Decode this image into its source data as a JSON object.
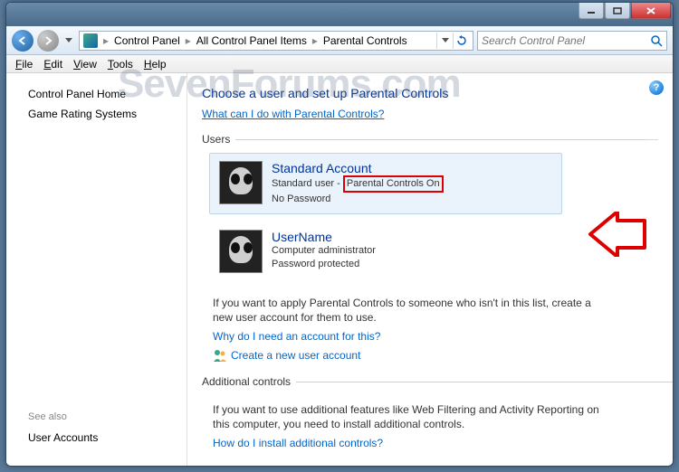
{
  "titlebar": {
    "min": "min",
    "max": "max",
    "close": "close"
  },
  "nav": {
    "breadcrumbs": [
      "Control Panel",
      "All Control Panel Items",
      "Parental Controls"
    ],
    "search_placeholder": "Search Control Panel"
  },
  "menu": {
    "file": "File",
    "edit": "Edit",
    "view": "View",
    "tools": "Tools",
    "help": "Help"
  },
  "sidebar": {
    "items": [
      "Control Panel Home",
      "Game Rating Systems"
    ],
    "seealso_label": "See also",
    "seealso_items": [
      "User Accounts"
    ]
  },
  "main": {
    "heading": "Choose a user and set up Parental Controls",
    "intro_link": "What can I do with Parental Controls?",
    "users_legend": "Users",
    "users": [
      {
        "name": "Standard Account",
        "type": "Standard user",
        "status": "Parental Controls On",
        "pw": "No Password",
        "selected": true,
        "highlighted": true
      },
      {
        "name": "UserName",
        "type": "Computer administrator",
        "status": "",
        "pw": "Password protected",
        "selected": false,
        "highlighted": false
      }
    ],
    "note1": "If you want to apply Parental Controls to someone who isn't in this list, create a new user account for them to use.",
    "why_link": "Why do I need an account for this?",
    "create_link": "Create a new user account",
    "additional_legend": "Additional controls",
    "note2": "If you want to use additional features like Web Filtering and Activity Reporting on this computer, you need to install additional controls.",
    "install_link": "How do I install additional controls?"
  },
  "watermark": "SevenForums.com"
}
